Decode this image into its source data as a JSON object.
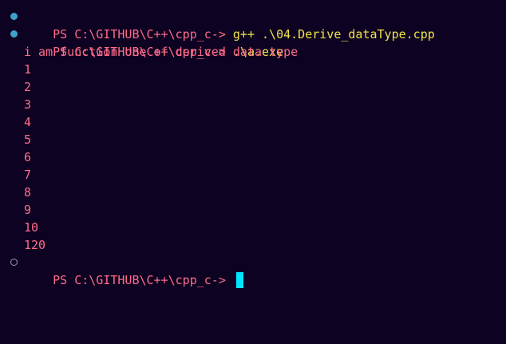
{
  "colors": {
    "background": "#0d0221",
    "prompt": "#ff6b8a",
    "command": "#f0e44a",
    "output": "#ff6b8a",
    "status_dot_success": "#3fa0c8",
    "status_dot_pending": "#9a9aa8",
    "cursor": "#00e5ff"
  },
  "terminal": {
    "commands": [
      {
        "status": "success",
        "prompt": "PS C:\\GITHUB\\C++\\cpp_c-> ",
        "command": "g++ .\\04.Derive_dataType.cpp"
      },
      {
        "status": "success",
        "prompt": "PS C:\\GITHUB\\C++\\cpp_c-> ",
        "command": ".\\a.exe"
      }
    ],
    "output_lines": [
      "i am function one of derived data type",
      "1",
      "2",
      "3",
      "4",
      "5",
      "6",
      "7",
      "8",
      "9",
      "10",
      "120"
    ],
    "current_prompt": {
      "status": "pending",
      "prompt": "PS C:\\GITHUB\\C++\\cpp_c-> ",
      "icon": "block-cursor"
    }
  }
}
